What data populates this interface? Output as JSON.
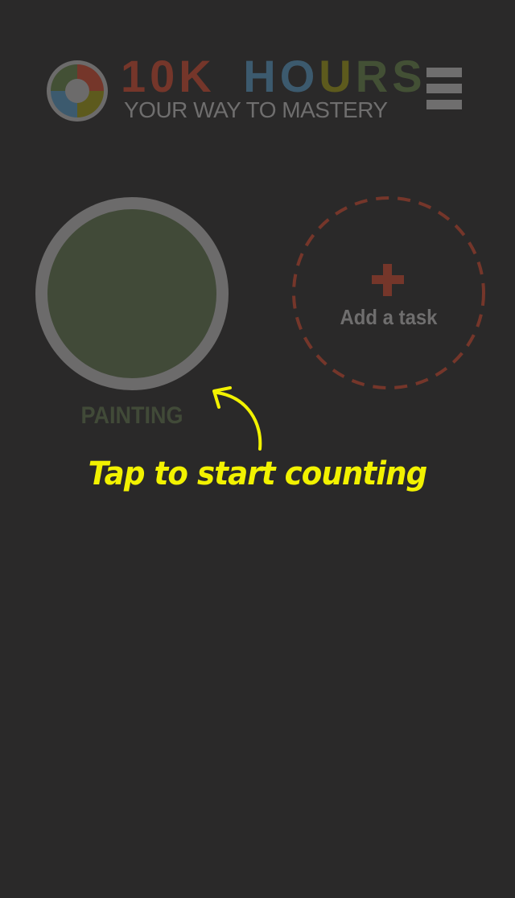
{
  "header": {
    "logo_icon": "color-wheel-logo-icon",
    "title_parts": [
      {
        "text": "10K",
        "color": "#75362a"
      },
      {
        "text": "HO",
        "color": "#3c5a6e"
      },
      {
        "text": "U",
        "color": "#5d5a1d"
      },
      {
        "text": "RS",
        "color": "#435035"
      }
    ],
    "subtitle": "YOUR WAY TO MASTERY",
    "menu_icon": "hamburger-menu-icon"
  },
  "tasks": [
    {
      "label": "PAINTING",
      "color": "#414a38"
    }
  ],
  "add_task": {
    "icon": "plus-icon",
    "label": "Add a task"
  },
  "hint": {
    "icon": "curved-arrow-icon",
    "text": "Tap to start counting",
    "color": "#f2f200"
  },
  "colors": {
    "background": "#2a2929",
    "wheel_red": "#75362a",
    "wheel_blue": "#3c5a6e",
    "wheel_olive": "#5d5a1d",
    "wheel_green": "#435035"
  }
}
